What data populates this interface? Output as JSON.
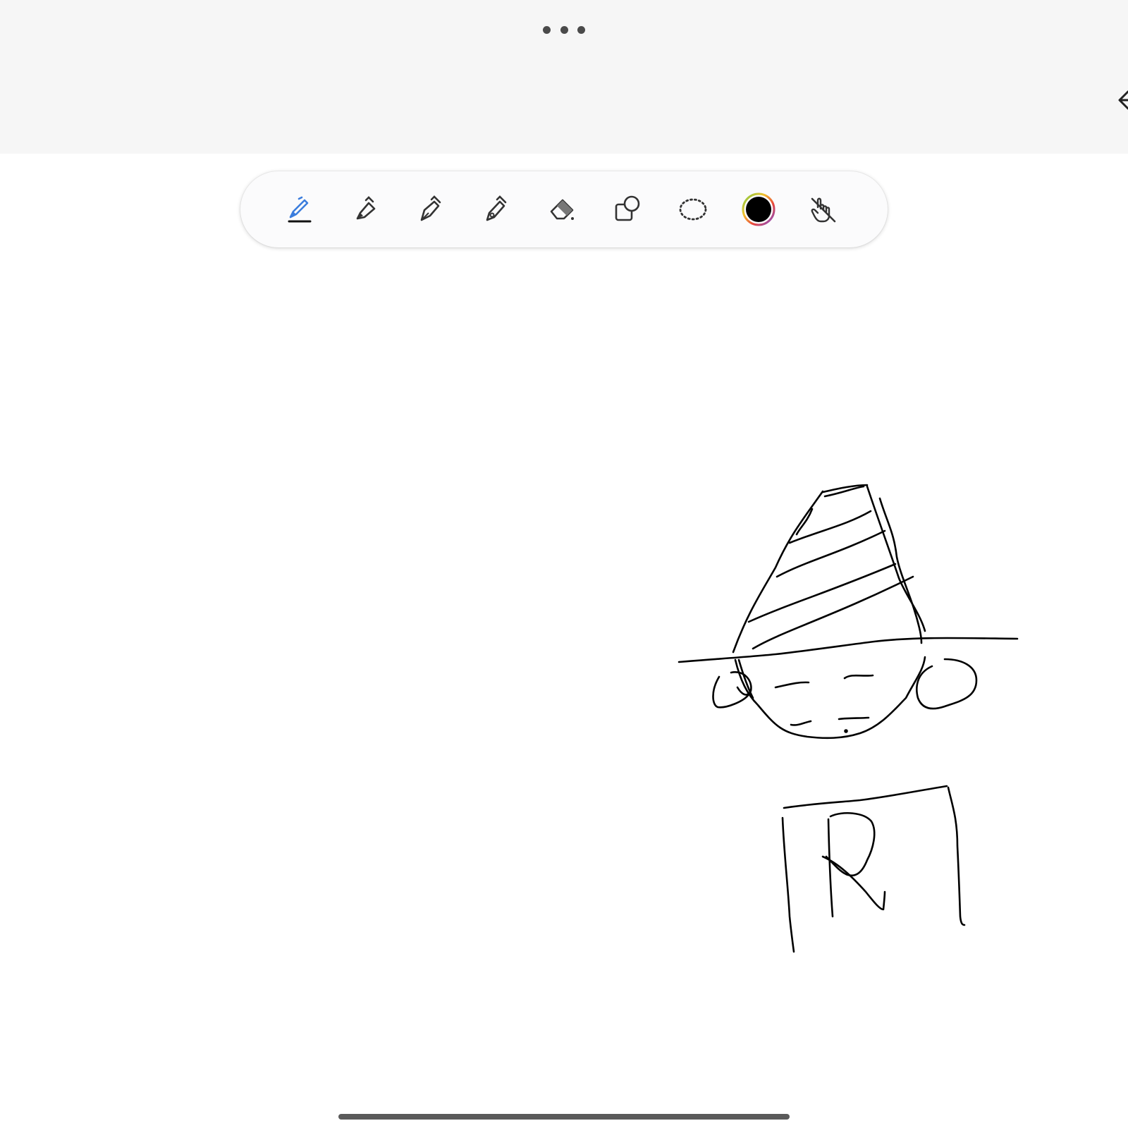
{
  "app": {
    "more_menu_icon": "more-horizontal-icon",
    "back_icon": "chevron-left-icon"
  },
  "toolbar": {
    "selected_tool": "pen",
    "tools": [
      {
        "name": "pen",
        "icon": "pen-icon",
        "selected": true
      },
      {
        "name": "highlighter",
        "icon": "highlighter-icon",
        "selected": false
      },
      {
        "name": "fountain-pen",
        "icon": "fountain-pen-icon",
        "selected": false
      },
      {
        "name": "calligraphy-pen",
        "icon": "calligraphy-pen-icon",
        "selected": false
      },
      {
        "name": "eraser",
        "icon": "eraser-icon",
        "selected": false
      },
      {
        "name": "shapes",
        "icon": "shapes-icon",
        "selected": false
      },
      {
        "name": "lasso-select",
        "icon": "lasso-icon",
        "selected": false
      },
      {
        "name": "color-picker",
        "icon": "color-swatch-icon",
        "selected": false
      },
      {
        "name": "touch-drawing-off",
        "icon": "hand-off-icon",
        "selected": false
      }
    ],
    "current_color": "#000000"
  },
  "colors": {
    "accent": "#3b7ddd",
    "ink": "#000000",
    "top_bar_background": "#f6f6f6"
  },
  "canvas": {
    "content": "hand-drawn-sketch",
    "sketch_letter": "R"
  }
}
